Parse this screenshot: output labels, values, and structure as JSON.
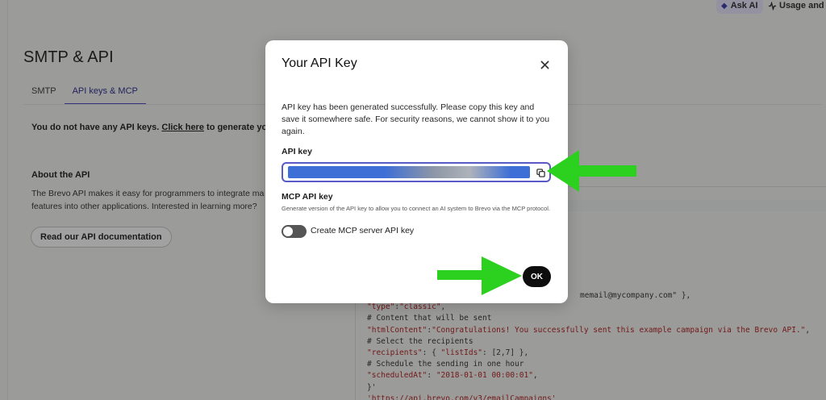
{
  "topbar": {
    "ask_ai": "Ask AI",
    "usage": "Usage and"
  },
  "page": {
    "title": "SMTP & API",
    "tabs": [
      {
        "label": "SMTP",
        "active": false
      },
      {
        "label": "API keys & MCP",
        "active": true
      }
    ],
    "no_keys_prefix": "You do not have any API keys. ",
    "no_keys_link": "Click here",
    "no_keys_suffix": " to generate your fir",
    "about_title": "About the API",
    "about_text": "The Brevo API makes it easy for programmers to integrate ma features into other applications. Interested in learning more?",
    "doc_button": "Read our API documentation"
  },
  "code": {
    "lines": [
      {
        "text": "memail@mycompany.com\" },",
        "indent": 264
      },
      {
        "text": "\"type\":\"classic\","
      },
      {
        "text": "# Content that will be sent"
      },
      {
        "text": "\"htmlContent\":\"Congratulations! You successfully sent this example campaign via the Brevo API.\","
      },
      {
        "text": "# Select the recipients"
      },
      {
        "text": "\"recipients\": { \"listIds\": [2,7] },"
      },
      {
        "text": "# Schedule the sending in one hour"
      },
      {
        "text": "\"scheduledAt\": \"2018-01-01 00:00:01\","
      },
      {
        "text": "}'"
      },
      {
        "text": "'https://api.brevo.com/v3/emailCampaigns'"
      }
    ]
  },
  "modal": {
    "title": "Your API Key",
    "message": "API key has been generated successfully. Please copy this key and save it somewhere safe. For security reasons, we cannot show it to you again.",
    "api_key_label": "API key",
    "api_key_value": "",
    "mcp_label": "MCP API key",
    "mcp_desc": "Generate version of the API key to allow you to connect an AI system to Brevo via the MCP protocol.",
    "toggle_label": "Create MCP server API key",
    "toggle_on": false,
    "ok_button": "OK"
  },
  "colors": {
    "accent": "#4a49c8",
    "ok_bg": "#0d0d0d",
    "arrow": "#2bd11e"
  },
  "icons": [
    "sparkle-icon",
    "activity-icon",
    "close-icon",
    "copy-icon"
  ]
}
